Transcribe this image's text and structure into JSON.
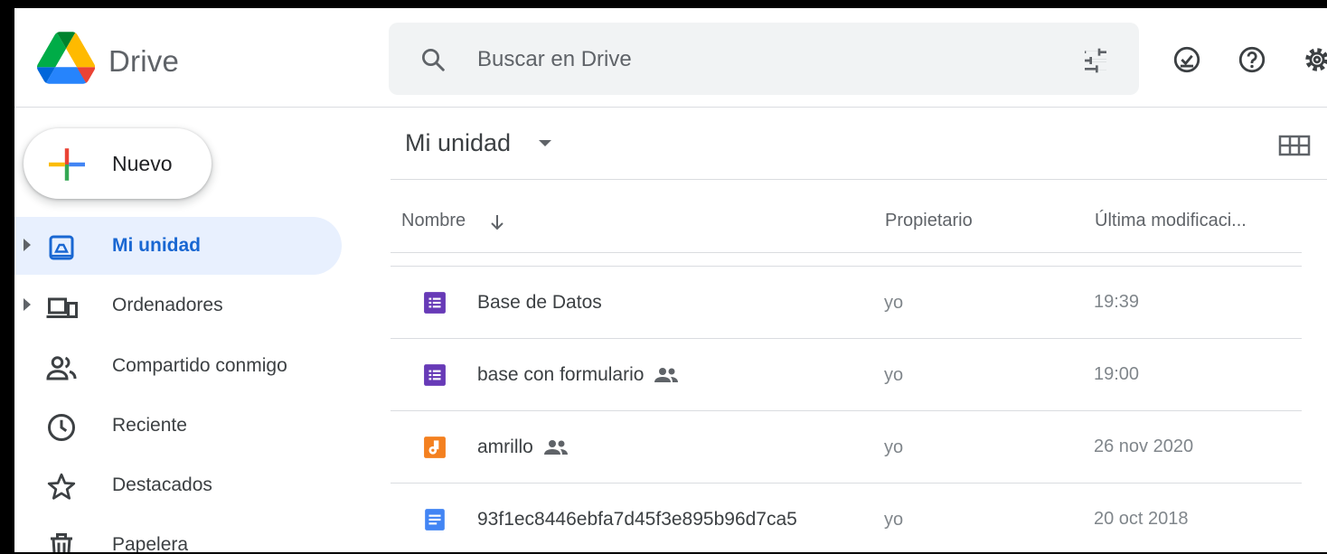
{
  "app": {
    "name": "Drive"
  },
  "search": {
    "placeholder": "Buscar en Drive"
  },
  "sidebar": {
    "new_label": "Nuevo",
    "items": [
      {
        "label": "Mi unidad",
        "icon": "my-drive-icon"
      },
      {
        "label": "Ordenadores",
        "icon": "computers-icon"
      },
      {
        "label": "Compartido conmigo",
        "icon": "shared-with-me-icon"
      },
      {
        "label": "Reciente",
        "icon": "clock-icon"
      },
      {
        "label": "Destacados",
        "icon": "star-icon"
      },
      {
        "label": "Papelera",
        "icon": "trash-icon"
      }
    ]
  },
  "main": {
    "title": "Mi unidad",
    "columns": {
      "name": "Nombre",
      "owner": "Propietario",
      "modified": "Última modificaci..."
    },
    "files": [
      {
        "name": "Base de Datos",
        "owner": "yo",
        "modified": "19:39",
        "type": "forms",
        "shared": false
      },
      {
        "name": "base con formulario",
        "owner": "yo",
        "modified": "19:00",
        "type": "forms",
        "shared": true
      },
      {
        "name": "amrillo",
        "owner": "yo",
        "modified": "26 nov 2020",
        "type": "jamboard",
        "shared": true
      },
      {
        "name": "93f1ec8446ebfa7d45f3e895b96d7ca5",
        "owner": "yo",
        "modified": "20 oct 2018",
        "type": "docs",
        "shared": false
      }
    ]
  },
  "colors": {
    "active_bg": "#e8f0fe",
    "active_text": "#1967d2",
    "forms": "#673ab7",
    "jamboard": "#f4801f",
    "docs": "#4285f4"
  }
}
